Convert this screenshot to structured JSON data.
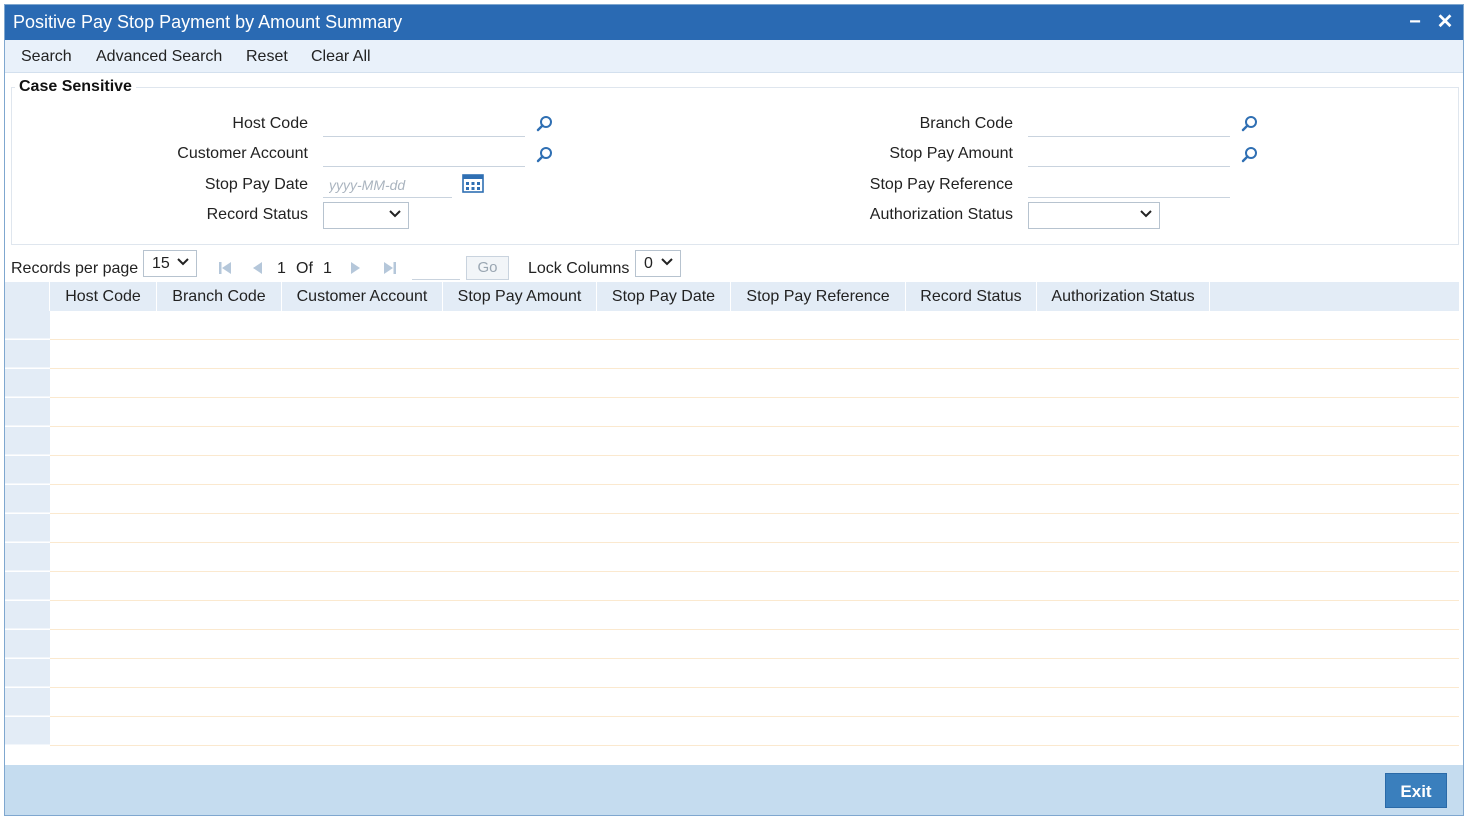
{
  "window": {
    "title": "Positive Pay Stop Payment by Amount Summary",
    "minimize": "−",
    "close": "✕"
  },
  "toolbar": {
    "search": "Search",
    "advanced_search": "Advanced Search",
    "reset": "Reset",
    "clear_all": "Clear All"
  },
  "criteria": {
    "legend": "Case Sensitive",
    "host_code": {
      "label": "Host Code",
      "value": ""
    },
    "customer_account": {
      "label": "Customer Account",
      "value": ""
    },
    "stop_pay_date": {
      "label": "Stop Pay Date",
      "placeholder": "yyyy-MM-dd"
    },
    "record_status": {
      "label": "Record Status",
      "value": ""
    },
    "branch_code": {
      "label": "Branch Code",
      "value": ""
    },
    "stop_pay_amount": {
      "label": "Stop Pay Amount",
      "value": ""
    },
    "stop_pay_reference": {
      "label": "Stop Pay Reference",
      "value": ""
    },
    "authorization_status": {
      "label": "Authorization Status",
      "value": ""
    }
  },
  "pager": {
    "records_per_page_label": "Records per page",
    "records_per_page": "15",
    "current_page": "1",
    "of_label": "Of",
    "total_pages": "1",
    "go_label": "Go",
    "lock_columns_label": "Lock Columns",
    "lock_columns": "0"
  },
  "grid": {
    "columns": [
      "Host Code",
      "Branch Code",
      "Customer Account",
      "Stop Pay Amount",
      "Stop Pay Date",
      "Stop Pay Reference",
      "Record Status",
      "Authorization Status"
    ],
    "rows": []
  },
  "footer": {
    "exit": "Exit"
  },
  "colors": {
    "title_bar": "#2a6ab3",
    "toolbar_bg": "#e9f1fa",
    "grid_header": "#e3ecf6",
    "footer_bg": "#c5dcef",
    "exit_button": "#3a7fbd",
    "icon_blue": "#2f6fb3"
  }
}
